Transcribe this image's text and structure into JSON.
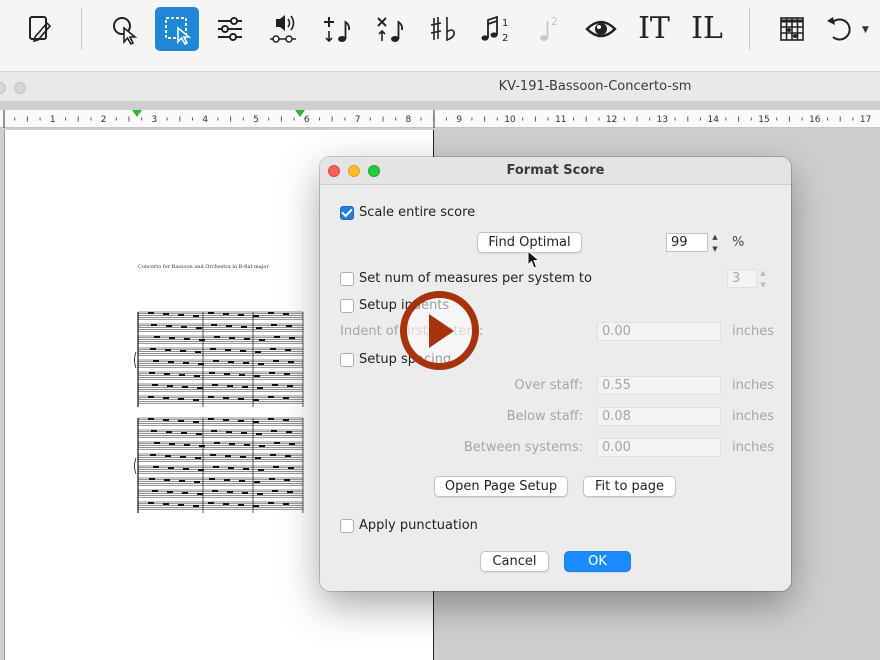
{
  "window": {
    "title": "KV-191-Bassoon-Concerto-sm"
  },
  "toolbar": {
    "text_tool_label": "IT",
    "lyrics_tool_label": "IL",
    "tuplet_label": "2",
    "tuplet_numbers": [
      "1",
      "2"
    ]
  },
  "ruler": {
    "labels": [
      "1",
      "2",
      "3",
      "4",
      "5",
      "6",
      "7",
      "8",
      "9",
      "10",
      "11",
      "12",
      "13",
      "14",
      "15",
      "16",
      "17"
    ]
  },
  "score": {
    "title": "Concerto for Bassoon and Orchestra in B-flat major"
  },
  "dialog": {
    "title": "Format Score",
    "scale_entire_score": {
      "label": "Scale entire score",
      "checked": true
    },
    "find_optimal_label": "Find Optimal",
    "scale_value": "99",
    "scale_unit": "%",
    "measures_per_system": {
      "label": "Set num of measures per system to",
      "value": "3",
      "checked": false
    },
    "setup_indents": {
      "label": "Setup indents",
      "checked": false
    },
    "indent_first_system": {
      "label": "Indent of first system:",
      "value": "0.00",
      "unit": "inches"
    },
    "setup_spacing": {
      "label": "Setup spacing",
      "checked": false
    },
    "over_staff": {
      "label": "Over staff:",
      "value": "0.55",
      "unit": "inches"
    },
    "below_staff": {
      "label": "Below staff:",
      "value": "0.08",
      "unit": "inches"
    },
    "between_systems": {
      "label": "Between systems:",
      "value": "0.00",
      "unit": "inches"
    },
    "open_page_setup_label": "Open Page Setup",
    "fit_to_page_label": "Fit to page",
    "apply_punctuation": {
      "label": "Apply punctuation",
      "checked": false
    },
    "cancel_label": "Cancel",
    "ok_label": "OK"
  },
  "colors": {
    "accent": "#1a8cff",
    "play_overlay": "#a6330c",
    "selected_tool": "#1f87d6"
  }
}
